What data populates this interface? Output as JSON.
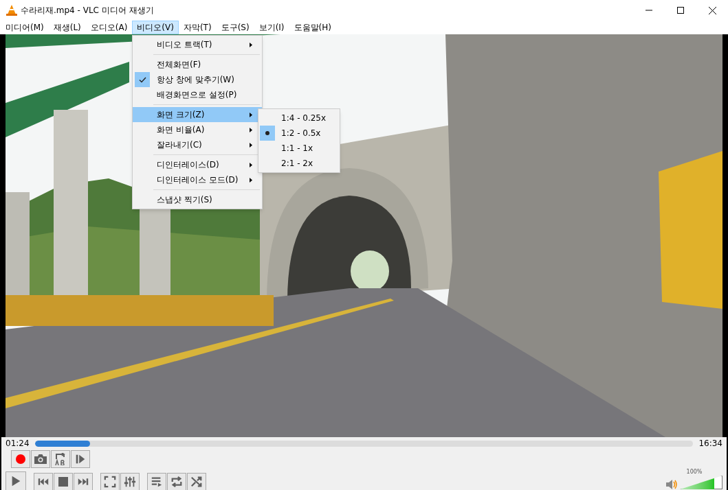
{
  "window": {
    "title": "수라리재.mp4 - VLC 미디어 재생기"
  },
  "menu_bar": [
    {
      "label": "미디어(M)",
      "selected": false
    },
    {
      "label": "재생(L)",
      "selected": false
    },
    {
      "label": "오디오(A)",
      "selected": false
    },
    {
      "label": "비디오(V)",
      "selected": true
    },
    {
      "label": "자막(T)",
      "selected": false
    },
    {
      "label": "도구(S)",
      "selected": false
    },
    {
      "label": "보기(I)",
      "selected": false
    },
    {
      "label": "도움말(H)",
      "selected": false
    }
  ],
  "video_menu": [
    {
      "kind": "item",
      "label": "비디오 트랙(T)",
      "checked": false,
      "submenu": true,
      "selected": false
    },
    {
      "kind": "separator"
    },
    {
      "kind": "item",
      "label": "전체화면(F)",
      "checked": false,
      "submenu": false,
      "selected": false
    },
    {
      "kind": "item",
      "label": "항상 창에 맞추기(W)",
      "checked": true,
      "submenu": false,
      "selected": false
    },
    {
      "kind": "item",
      "label": "배경화면으로 설정(P)",
      "checked": false,
      "submenu": false,
      "selected": false
    },
    {
      "kind": "separator"
    },
    {
      "kind": "item",
      "label": "화면 크기(Z)",
      "checked": false,
      "submenu": true,
      "selected": true
    },
    {
      "kind": "item",
      "label": "화면 비율(A)",
      "checked": false,
      "submenu": true,
      "selected": false
    },
    {
      "kind": "item",
      "label": "잘라내기(C)",
      "checked": false,
      "submenu": true,
      "selected": false
    },
    {
      "kind": "separator"
    },
    {
      "kind": "item",
      "label": "디인터레이스(D)",
      "checked": false,
      "submenu": true,
      "selected": false
    },
    {
      "kind": "item",
      "label": "디인터레이스 모드(D)",
      "checked": false,
      "submenu": true,
      "selected": false
    },
    {
      "kind": "separator"
    },
    {
      "kind": "item",
      "label": "스냅샷 찍기(S)",
      "checked": false,
      "submenu": false,
      "selected": false
    }
  ],
  "zoom_submenu": [
    {
      "label": "1:4 - 0.25x",
      "selected": false
    },
    {
      "label": "1:2 - 0.5x",
      "selected": true
    },
    {
      "label": "1:1 - 1x",
      "selected": false
    },
    {
      "label": "2:1 - 2x",
      "selected": false
    }
  ],
  "playback": {
    "elapsed": "01:24",
    "total": "16:34",
    "progress": {
      "level": 0.084
    }
  },
  "volume": {
    "reading": "100%",
    "level": 0.8
  }
}
